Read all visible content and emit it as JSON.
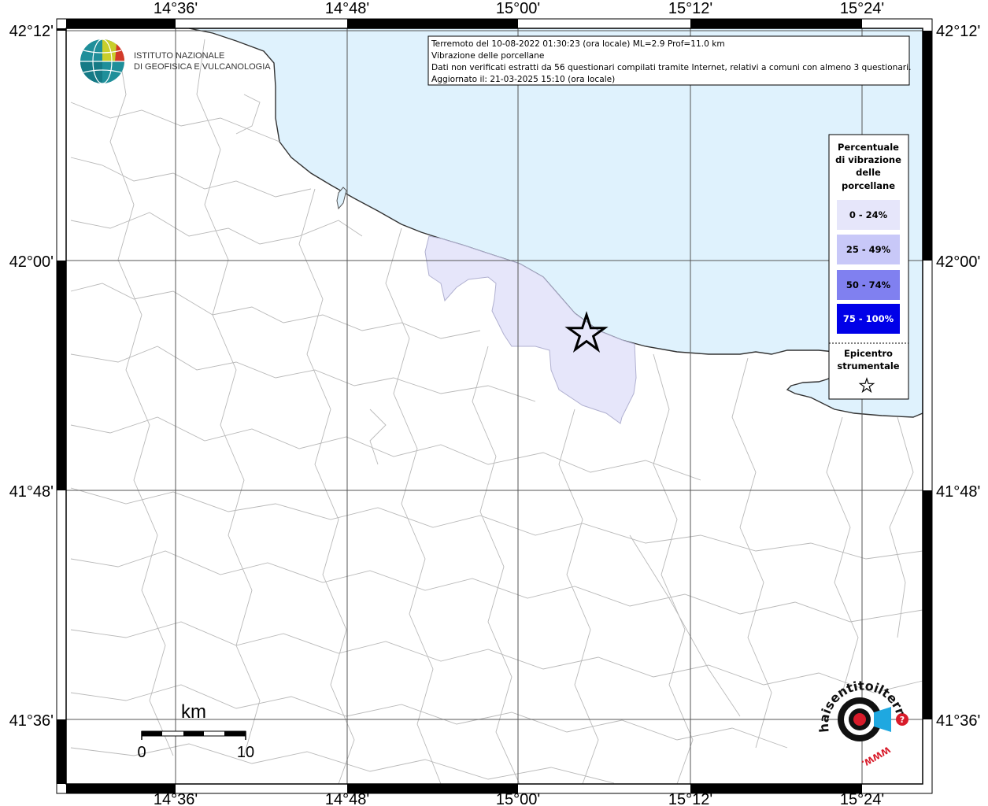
{
  "header": {
    "line1": "Terremoto del 10-08-2022 01:30:23 (ora locale) ML=2.9 Prof=11.0 km",
    "line2": "Vibrazione delle porcellane",
    "line3": "Dati non verificati estratti da 56 questionari compilati tramite Internet, relativi a comuni con almeno 3 questionari.",
    "line4": "Aggiornato il: 21-03-2025 15:10 (ora locale)"
  },
  "organization": {
    "line1": "ISTITUTO NAZIONALE",
    "line2": "DI GEOFISICA E VULCANOLOGIA"
  },
  "legend": {
    "title_lines": [
      "Percentuale",
      "di vibrazione",
      "delle",
      "porcellane"
    ],
    "classes": [
      {
        "label": "0 - 24%",
        "color": "#e6e6fa",
        "text_color": "#000000"
      },
      {
        "label": "25 - 49%",
        "color": "#c8c8f8",
        "text_color": "#000000"
      },
      {
        "label": "50 - 74%",
        "color": "#8080f0",
        "text_color": "#000000"
      },
      {
        "label": "75 - 100%",
        "color": "#0000e8",
        "text_color": "#ffffff"
      }
    ],
    "epicenter_lines": [
      "Epicentro",
      "strumentale"
    ]
  },
  "axes": {
    "top": [
      "14°36'",
      "14°48'",
      "15°00'",
      "15°12'",
      "15°24'"
    ],
    "bottom": [
      "14°36'",
      "14°48'",
      "15°00'",
      "15°12'",
      "15°24'"
    ],
    "left": [
      "42°12'",
      "42°00'",
      "41°48'",
      "41°36'"
    ],
    "right": [
      "42°12'",
      "42°00'",
      "41°48'",
      "41°36'"
    ]
  },
  "scale_bar": {
    "unit": "km",
    "min_label": "0",
    "max_label": "10"
  },
  "watermark": {
    "site": "haisentitoilterremoto.it",
    "url": "WWW."
  },
  "colors": {
    "sea": "#dff2fd",
    "boundary": "#b9b9b9",
    "grid": "#555555",
    "felt": "#e6e6fa"
  },
  "symbols": {
    "epicenter": "star-icon"
  }
}
